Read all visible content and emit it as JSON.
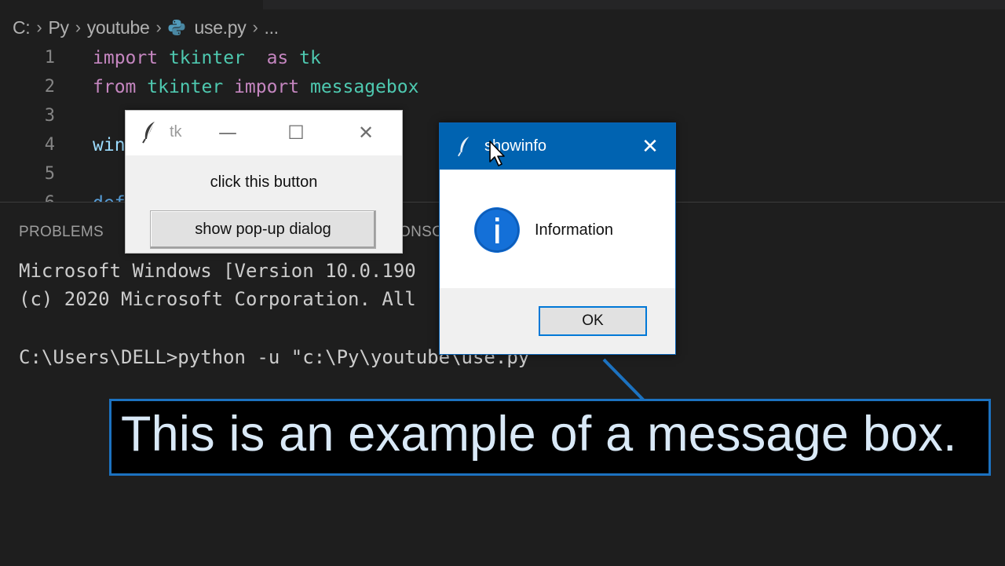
{
  "breadcrumb": {
    "items": [
      "C:",
      "Py",
      "youtube",
      "use.py",
      "..."
    ]
  },
  "editor": {
    "lines": [
      {
        "number": "1",
        "tokens": [
          {
            "text": "import",
            "type": "kw"
          },
          {
            "text": " ",
            "type": "plain"
          },
          {
            "text": "tkinter",
            "type": "mod"
          },
          {
            "text": "  as ",
            "type": "kw"
          },
          {
            "text": "tk",
            "type": "mod"
          }
        ]
      },
      {
        "number": "2",
        "tokens": [
          {
            "text": "from",
            "type": "kw"
          },
          {
            "text": " ",
            "type": "plain"
          },
          {
            "text": "tkinter",
            "type": "mod"
          },
          {
            "text": " import ",
            "type": "kw"
          },
          {
            "text": "messagebox",
            "type": "mod"
          }
        ]
      },
      {
        "number": "3",
        "tokens": []
      },
      {
        "number": "4",
        "tokens": [
          {
            "text": "win",
            "type": "var"
          }
        ]
      },
      {
        "number": "5",
        "tokens": []
      },
      {
        "number": "6",
        "tokens": [
          {
            "text": "def",
            "type": "fn"
          }
        ]
      }
    ]
  },
  "panel": {
    "tab_problems": "PROBLEMS",
    "tab_console_partial": "ONSC",
    "terminal_lines": [
      "Microsoft Windows [Version 10.0.190",
      "(c) 2020 Microsoft Corporation. All",
      "",
      "C:\\Users\\DELL>python -u \"c:\\Py\\youtube\\use.py\""
    ]
  },
  "tk_window": {
    "title": "tk",
    "minimize_glyph": "—",
    "maximize_glyph": "☐",
    "close_glyph": "✕",
    "label": "click this button",
    "button_label": "show pop-up dialog"
  },
  "dialog": {
    "title": "showinfo",
    "close_glyph": "✕",
    "message": "Information",
    "ok_label": "OK",
    "icon": "info-icon"
  },
  "callout": {
    "text": "This is an example of a message box."
  },
  "colors": {
    "editor_bg": "#1e1e1e",
    "keyword": "#c586c0",
    "module": "#4ec9b0",
    "dialog_titlebar": "#0063b1",
    "callout_border": "#1c72c0"
  }
}
